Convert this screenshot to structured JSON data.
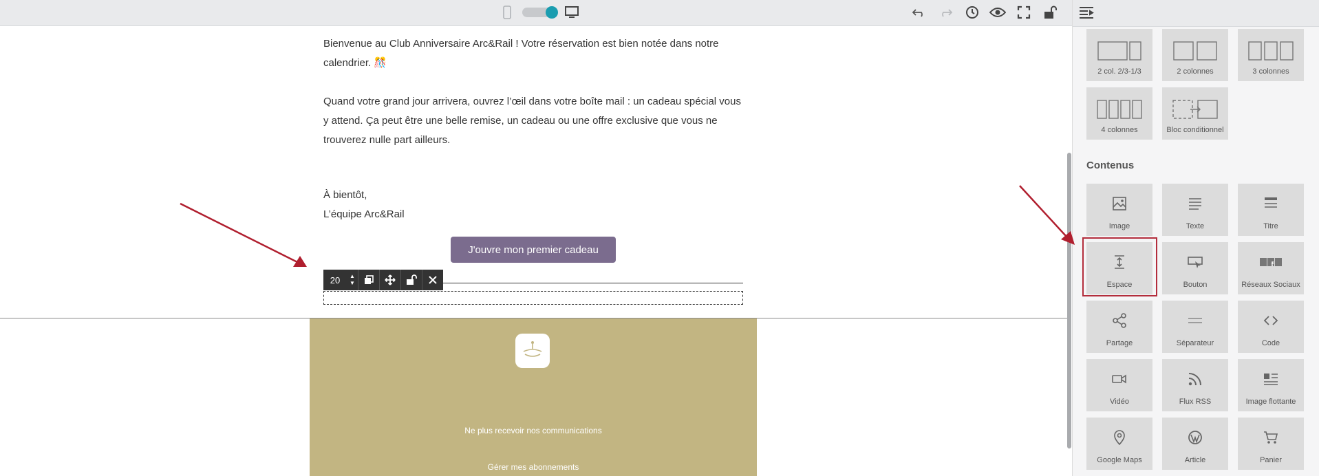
{
  "body_text": {
    "para1_line1": "Bienvenue au Club Anniversaire Arc&Rail ! Votre réservation est bien notée dans notre",
    "para1_line2": "calendrier.",
    "para2_line1": "Quand votre grand jour arrivera, ouvrez l’œil dans votre boîte mail : un cadeau spécial vous",
    "para2_line2": "y attend. Ça peut être une belle remise, un cadeau ou une offre exclusive que vous ne",
    "para2_line3": "trouverez nulle part ailleurs.",
    "signoff": "À bientôt,",
    "team": "L’équipe Arc&Rail"
  },
  "cta": {
    "label": "J'ouvre mon premier cadeau",
    "color": "#7b6c8e"
  },
  "spacer_toolbar": {
    "value": "20"
  },
  "footer": {
    "unsubscribe": "Ne plus recevoir nos communications",
    "manage": "Gérer mes abonnements",
    "bg_color": "#c2b582"
  },
  "sidebar": {
    "layouts": [
      "2 col. 2/3-1/3",
      "2 colonnes",
      "3 colonnes",
      "4 colonnes",
      "Bloc conditionnel"
    ],
    "section_title": "Contenus",
    "contents": [
      {
        "label": "Image",
        "icon": "image-icon"
      },
      {
        "label": "Texte",
        "icon": "text-icon"
      },
      {
        "label": "Titre",
        "icon": "title-icon"
      },
      {
        "label": "Espace",
        "icon": "spacer-icon"
      },
      {
        "label": "Bouton",
        "icon": "button-icon"
      },
      {
        "label": "Réseaux Sociaux",
        "icon": "social-icon"
      },
      {
        "label": "Partage",
        "icon": "share-icon"
      },
      {
        "label": "Séparateur",
        "icon": "separator-icon"
      },
      {
        "label": "Code",
        "icon": "code-icon"
      },
      {
        "label": "Vidéo",
        "icon": "video-icon"
      },
      {
        "label": "Flux RSS",
        "icon": "rss-icon"
      },
      {
        "label": "Image flottante",
        "icon": "floating-image-icon"
      },
      {
        "label": "Google Maps",
        "icon": "map-pin-icon"
      },
      {
        "label": "Article",
        "icon": "wordpress-icon"
      },
      {
        "label": "Panier",
        "icon": "cart-icon"
      }
    ]
  },
  "colors": {
    "accent": "#1a9db0",
    "highlight": "#b32d3c",
    "arrow": "#b01e2e"
  }
}
